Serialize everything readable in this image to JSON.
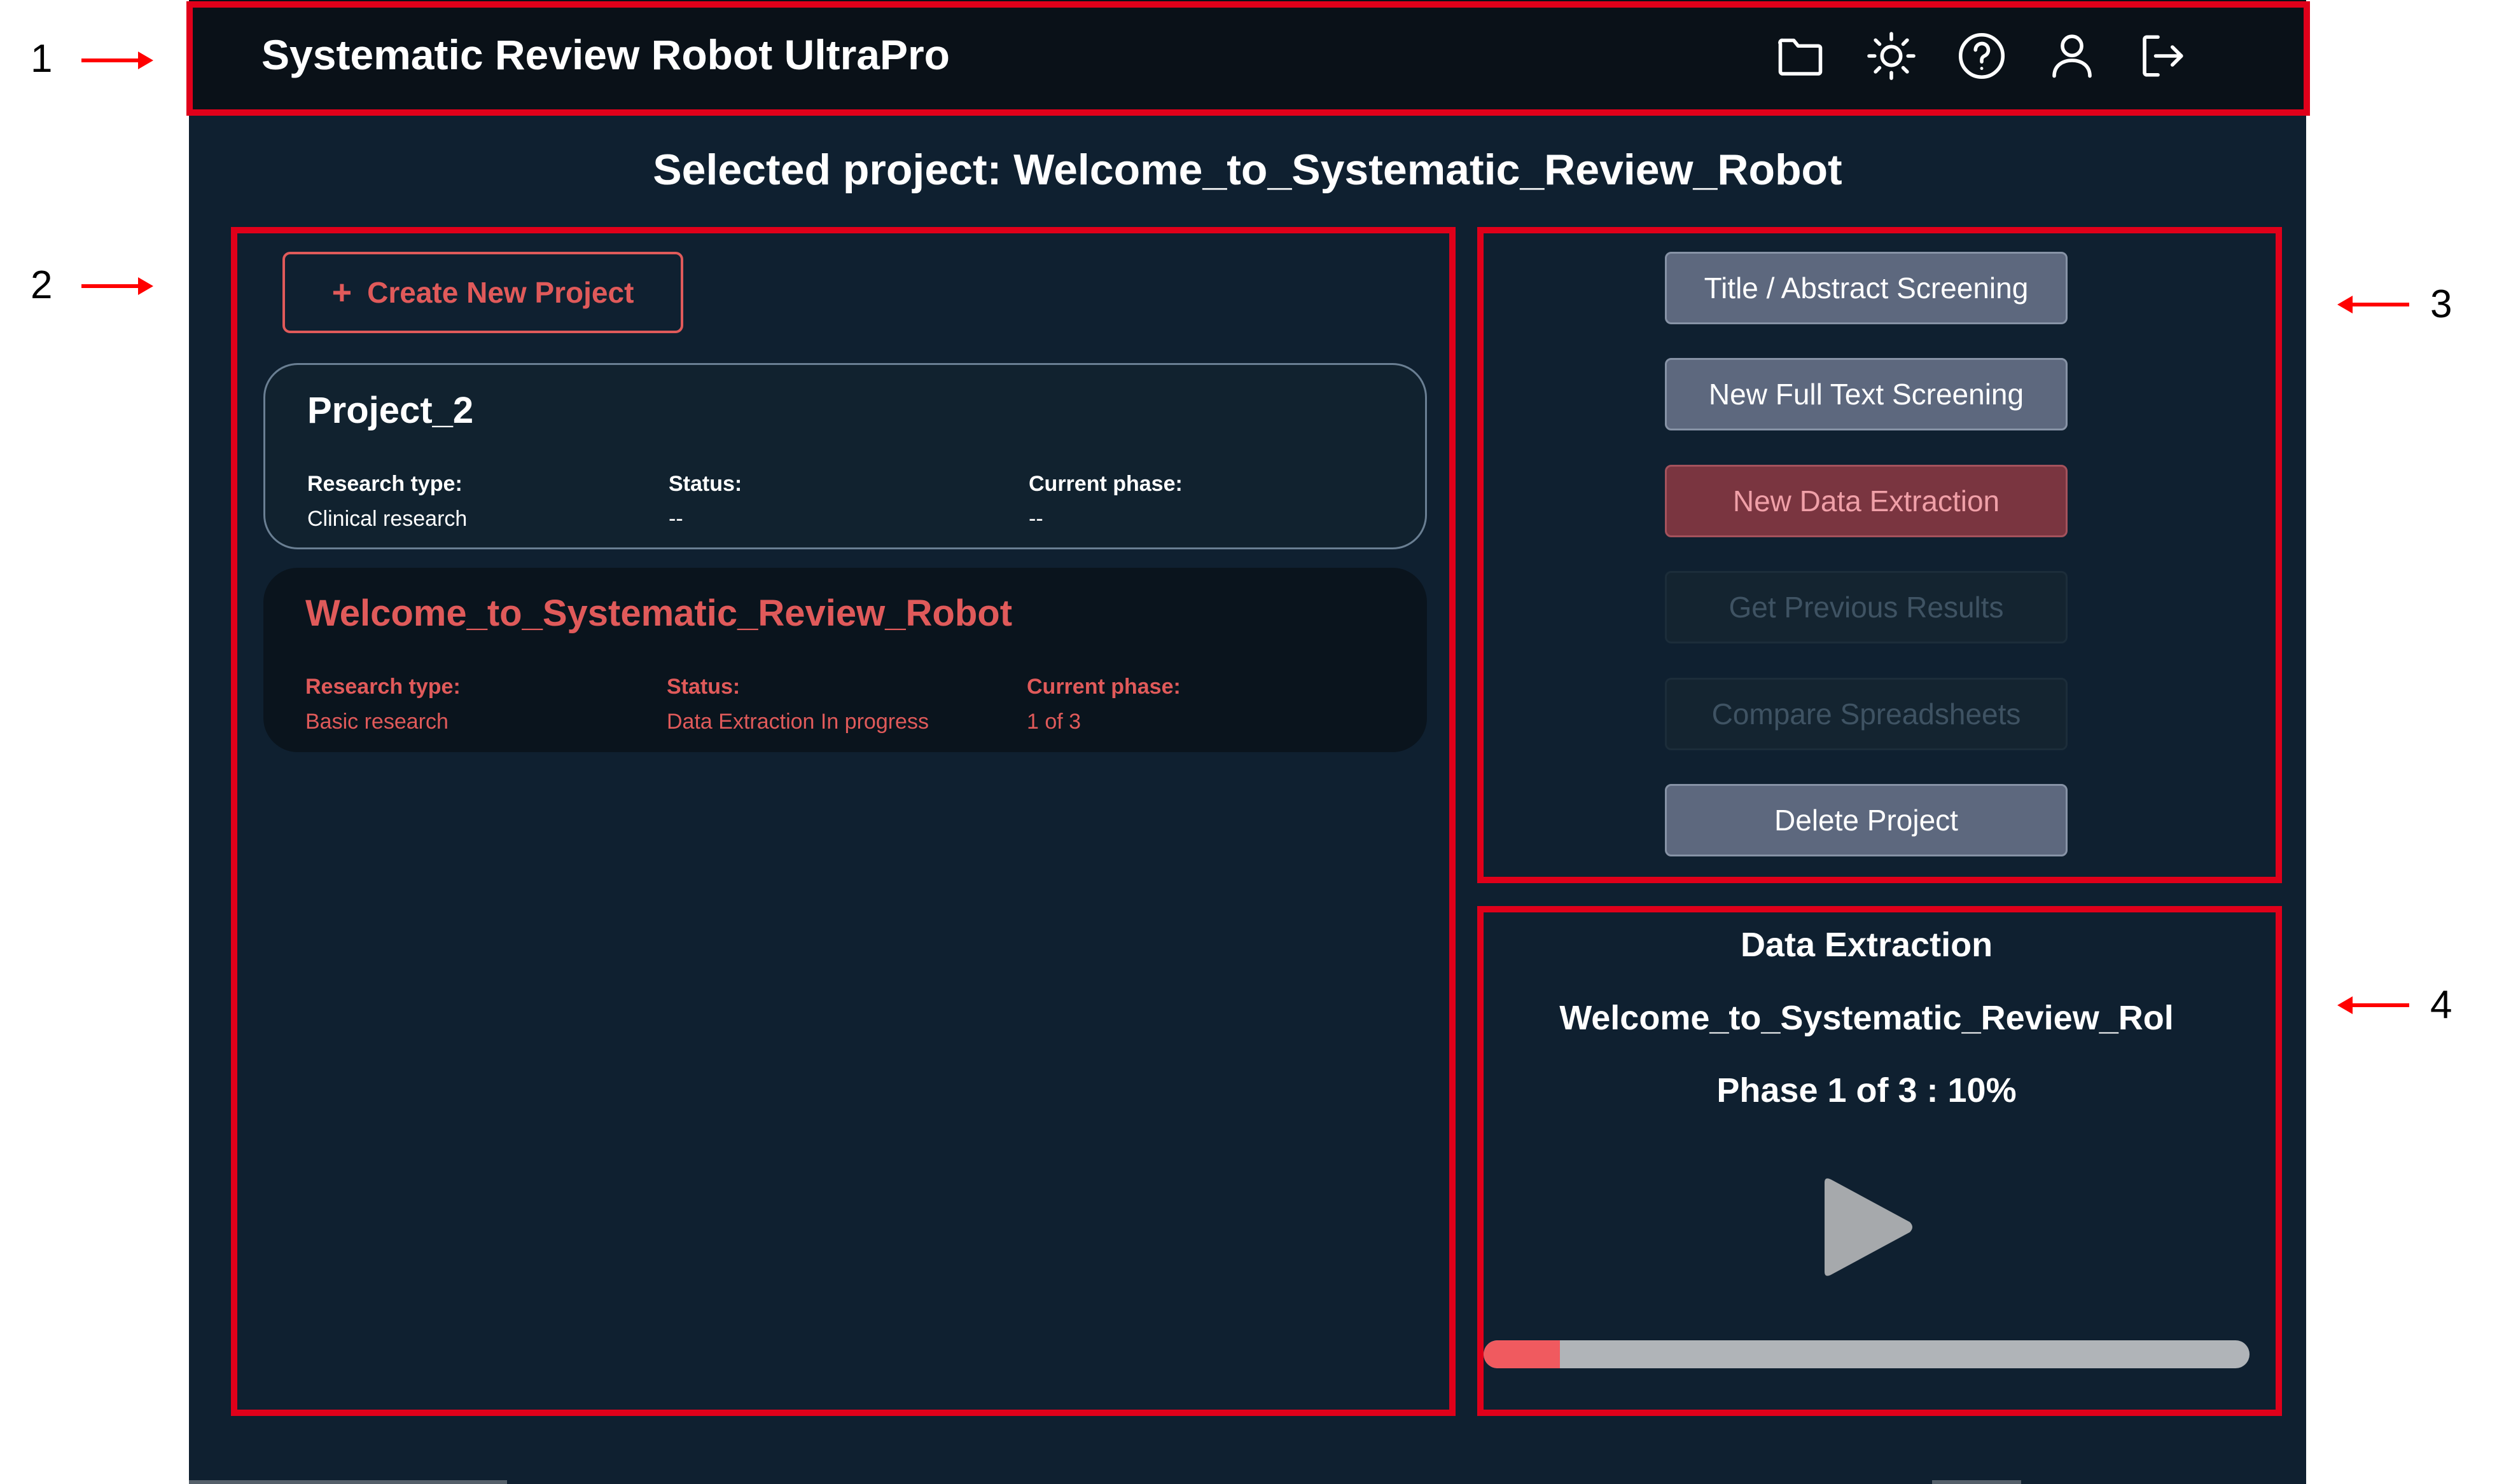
{
  "annotations": {
    "n1": "1",
    "n2": "2",
    "n3": "3",
    "n4": "4"
  },
  "header": {
    "app_title": "Systematic Review Robot UltraPro",
    "icons": [
      "folder-icon",
      "sun-icon",
      "help-icon",
      "user-icon",
      "logout-icon"
    ]
  },
  "selected_project": "Selected project: Welcome_to_Systematic_Review_Robot",
  "create_button": {
    "icon": "+",
    "label": "Create New Project"
  },
  "projects": [
    {
      "name": "Project_2",
      "research_type_label": "Research type:",
      "research_type": "Clinical research",
      "status_label": "Status:",
      "status": "--",
      "phase_label": "Current phase:",
      "phase": "--"
    },
    {
      "name": "Welcome_to_Systematic_Review_Robot",
      "research_type_label": "Research type:",
      "research_type": "Basic research",
      "status_label": "Status:",
      "status": "Data Extraction In progress",
      "phase_label": "Current phase:",
      "phase": "1 of 3"
    }
  ],
  "actions": {
    "title_abstract": "Title / Abstract Screening",
    "full_text": "New Full Text Screening",
    "data_extraction": "New Data Extraction",
    "previous_results": "Get Previous Results",
    "compare": "Compare Spreadsheets",
    "delete": "Delete Project"
  },
  "data_extraction": {
    "heading": "Data Extraction",
    "project": "Welcome_to_Systematic_Review_Rol",
    "phase_text": "Phase 1 of 3 : 10%",
    "progress_fraction": 0.1
  },
  "colors": {
    "accent": "#e05a5a",
    "app_background": "#0f2030",
    "header_background": "#0a1118",
    "annotation_red": "#e0001a",
    "progress_fill": "#f05a5f"
  }
}
